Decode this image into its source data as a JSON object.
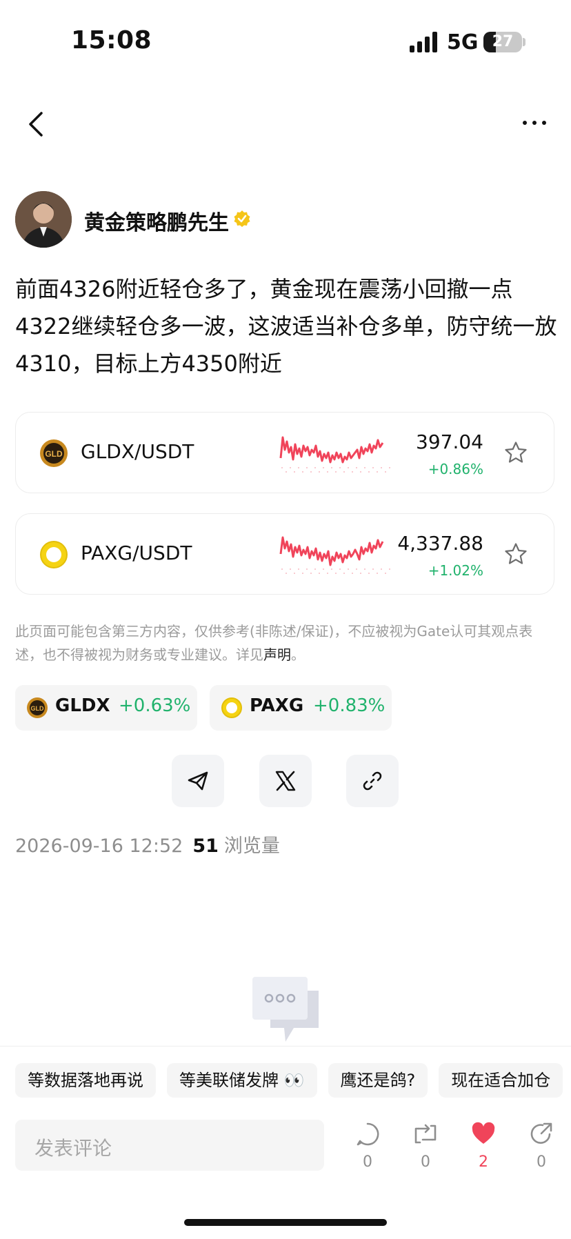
{
  "status_bar": {
    "time": "15:08",
    "network": "5G",
    "battery": "27"
  },
  "author": {
    "name": "黄金策略鹏先生"
  },
  "post": {
    "text": "前面4326附近轻仓多了，黄金现在震荡小回撤一点4322继续轻仓多一波，这波适当补仓多单，防守统一放4310，目标上方4350附近"
  },
  "cards": [
    {
      "pair": "GLDX/USDT",
      "icon_label": "GLD",
      "price": "397.04",
      "change": "+0.86%"
    },
    {
      "pair": "PAXG/USDT",
      "price": "4,337.88",
      "change": "+1.02%"
    }
  ],
  "disclaimer": {
    "text": "此页面可能包含第三方内容，仅供参考(非陈述/保证)，不应被视为Gate认可其观点表述，也不得被视为财务或专业建议。详见",
    "link": "声明",
    "end": "。"
  },
  "tags": [
    {
      "name": "GLDX",
      "change": "+0.63%",
      "icon_label": "GLD"
    },
    {
      "name": "PAXG",
      "change": "+0.83%"
    }
  ],
  "share": [
    {
      "icon": "telegram-icon"
    },
    {
      "icon": "x-icon"
    },
    {
      "icon": "link-icon"
    }
  ],
  "meta": {
    "datetime": "2026-09-16 12:52",
    "views": "51",
    "views_label": "浏览量"
  },
  "chips": [
    "等数据落地再说",
    "等美联储发牌 👀",
    "鹰还是鸽?",
    "现在适合加仓"
  ],
  "comment": {
    "placeholder": "发表评论"
  },
  "actions": [
    {
      "icon": "comment-icon",
      "count": "0"
    },
    {
      "icon": "repost-icon",
      "count": "0"
    },
    {
      "icon": "heart-icon",
      "count": "2"
    },
    {
      "icon": "share-icon",
      "count": "0"
    }
  ],
  "colors": {
    "positive": "#20b26c",
    "spark": "#f0445a",
    "heart": "#f0445a"
  }
}
